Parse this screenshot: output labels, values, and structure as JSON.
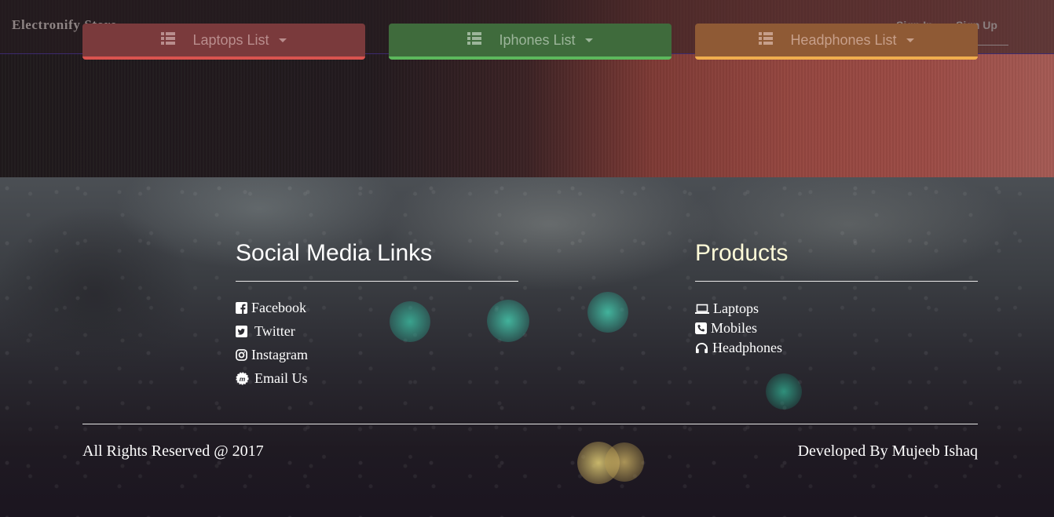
{
  "navbar": {
    "brand": "Electronify Store",
    "sign_in": "Sign In",
    "sign_up": "Sign Up"
  },
  "dropdowns": [
    {
      "label": "Laptops List",
      "icon": "list-icon",
      "color": "#d9534f"
    },
    {
      "label": "Iphones List",
      "icon": "list-icon",
      "color": "#5cb85c"
    },
    {
      "label": "Headphones List",
      "icon": "list-icon",
      "color": "#f0ad4e"
    }
  ],
  "footer": {
    "social": {
      "title": "Social Media Links",
      "title_color": "#ffffff",
      "links": [
        {
          "label": "Facebook",
          "icon": "facebook-icon"
        },
        {
          "label": "Twitter",
          "icon": "twitter-icon"
        },
        {
          "label": "Instagram",
          "icon": "instagram-icon"
        },
        {
          "label": "Email Us",
          "icon": "email-icon"
        }
      ]
    },
    "products": {
      "title": "Products",
      "title_color": "#fffbd8",
      "links": [
        {
          "label": "Laptops",
          "icon": "laptop-icon"
        },
        {
          "label": "Mobiles",
          "icon": "phone-icon"
        },
        {
          "label": "Headphones",
          "icon": "headphones-icon"
        }
      ]
    },
    "copyright": "All Rights Reserved @ 2017",
    "developer": "Developed By Mujeeb Ishaq"
  }
}
